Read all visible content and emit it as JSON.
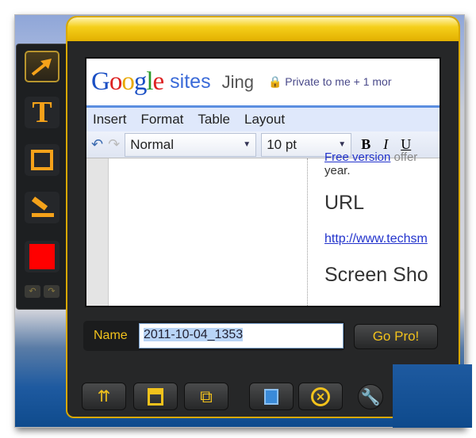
{
  "toolbar": {
    "tools": [
      "arrow-tool",
      "text-tool",
      "rectangle-tool",
      "highlighter-tool",
      "color-picker"
    ],
    "color": "#ff0000",
    "undo": "↶",
    "redo": "↷"
  },
  "capture": {
    "logo": "Google",
    "product": "sites",
    "site": "Jing",
    "privacy": "Private to me + 1 mor",
    "menu": [
      "Insert",
      "Format",
      "Table",
      "Layout"
    ],
    "style_select": "Normal",
    "size_select": "10 pt",
    "bold": "B",
    "italic": "I",
    "underline": "U",
    "content": {
      "link1": "Free version",
      "text1": "offer",
      "year": "year.",
      "heading": "URL",
      "url": "http://www.techsm",
      "heading2": "Screen Sho"
    }
  },
  "name_label": "Name",
  "name_value": "2011-10-04_1353",
  "go_pro": "Go Pro!",
  "accent": "#f2c21c"
}
